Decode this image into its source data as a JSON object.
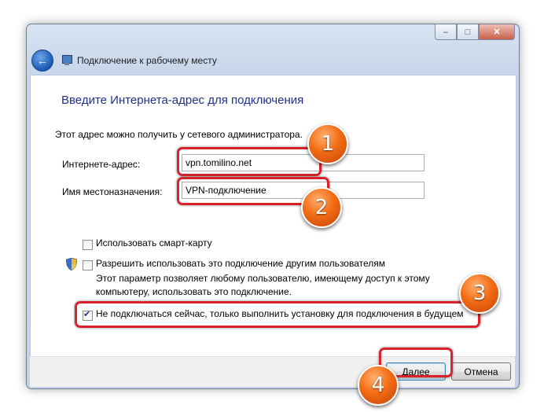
{
  "window": {
    "title": "Подключение к рабочему месту",
    "controls": {
      "minimize": "‒",
      "maximize": "□",
      "close": "✕"
    }
  },
  "main": {
    "heading": "Введите Интернета-адрес для подключения",
    "hint": "Этот адрес можно получить у сетевого администратора.",
    "address_label": "Интернете-адрес:",
    "address_value": "vpn.tomilino.net",
    "dest_label": "Имя местоназначения:",
    "dest_value": "VPN-подключение",
    "smartcard_label": "Использовать смарт-карту",
    "smartcard_checked": false,
    "allow_others_label": "Разрешить использовать это подключение другим пользователям",
    "allow_others_checked": false,
    "allow_others_desc_line1": "Этот параметр позволяет любому пользователю, имеющему доступ к этому",
    "allow_others_desc_line2": "компьютеру, использовать это подключение.",
    "no_connect_label": "Не подключаться сейчас, только выполнить установку для подключения в будущем",
    "no_connect_checked": true
  },
  "footer": {
    "next_label": "Далее",
    "cancel_label": "Отмена"
  },
  "annotations": {
    "badges": [
      "1",
      "2",
      "3",
      "4"
    ],
    "highlight_color": "#d9232c",
    "badge_color": "#f26d14"
  },
  "icons": {
    "back": "back-arrow-icon",
    "wizard": "network-computer-icon",
    "shield": "uac-shield-icon"
  }
}
